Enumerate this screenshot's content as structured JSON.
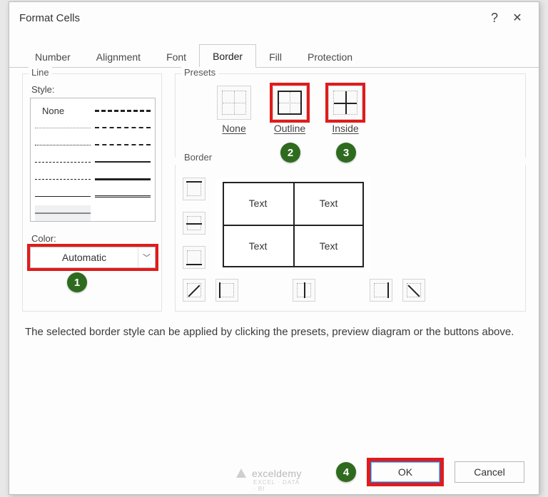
{
  "dialog": {
    "title": "Format Cells",
    "tabs": [
      "Number",
      "Alignment",
      "Font",
      "Border",
      "Fill",
      "Protection"
    ],
    "active_tab": "Border"
  },
  "line": {
    "section_label": "Line",
    "style_label": "Style:",
    "none_label": "None",
    "color_label": "Color:",
    "color_value": "Automatic"
  },
  "presets": {
    "section_label": "Presets",
    "items": [
      {
        "label": "None"
      },
      {
        "label": "Outline"
      },
      {
        "label": "Inside"
      }
    ]
  },
  "border": {
    "section_label": "Border",
    "cell_text": "Text"
  },
  "description": "The selected border style can be applied by clicking the presets, preview diagram or the buttons above.",
  "buttons": {
    "ok": "OK",
    "cancel": "Cancel"
  },
  "badges": {
    "color": "1",
    "outline": "2",
    "inside": "3",
    "ok": "4"
  },
  "watermark": {
    "text": "exceldemy",
    "sub": "EXCEL · DATA · BI"
  }
}
